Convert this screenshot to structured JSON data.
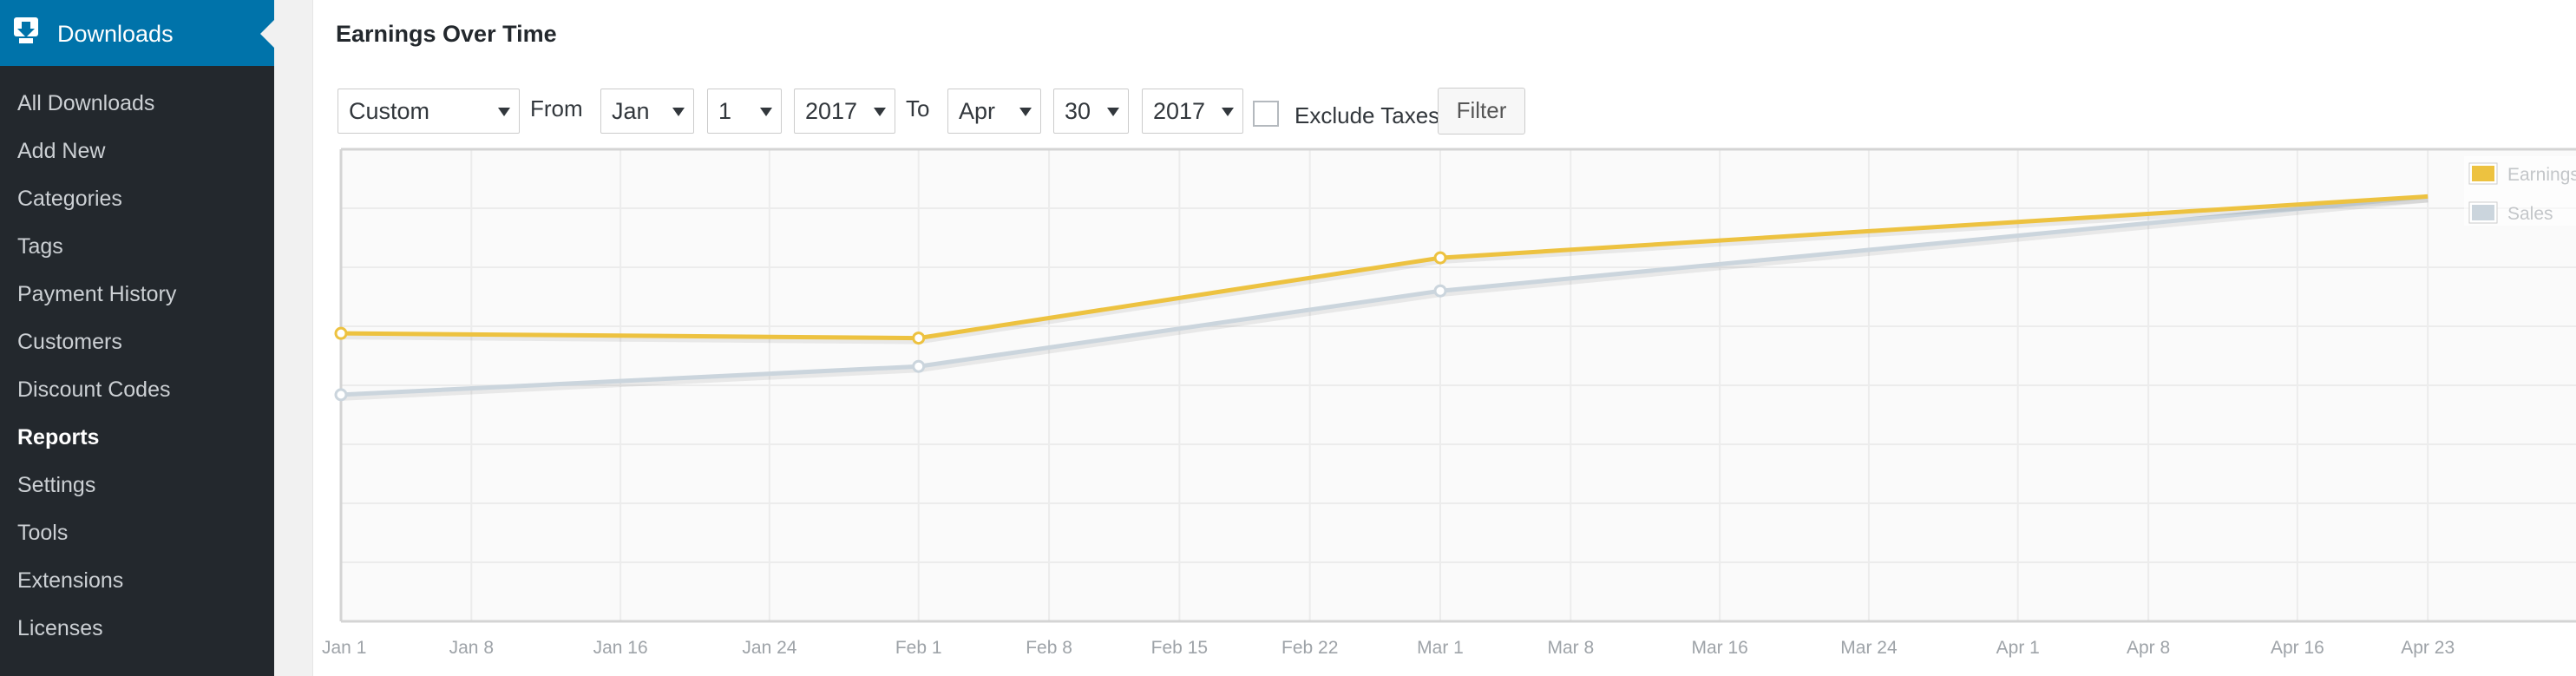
{
  "sidebar": {
    "top": {
      "label": "Downloads",
      "icon": "download-icon"
    },
    "items": [
      {
        "label": "All Downloads"
      },
      {
        "label": "Add New"
      },
      {
        "label": "Categories"
      },
      {
        "label": "Tags"
      },
      {
        "label": "Payment History"
      },
      {
        "label": "Customers"
      },
      {
        "label": "Discount Codes"
      },
      {
        "label": "Reports",
        "current": true
      },
      {
        "label": "Settings"
      },
      {
        "label": "Tools"
      },
      {
        "label": "Extensions"
      },
      {
        "label": "Licenses"
      }
    ]
  },
  "panel": {
    "title": "Earnings Over Time"
  },
  "filters": {
    "range": "Custom",
    "from_label": "From",
    "from_month": "Jan",
    "from_day": "1",
    "from_year": "2017",
    "to_label": "To",
    "to_month": "Apr",
    "to_day": "30",
    "to_year": "2017",
    "exclude_taxes_label": "Exclude Taxes",
    "exclude_taxes_checked": false,
    "filter_button": "Filter"
  },
  "colors": {
    "earnings": "#edc240",
    "sales": "#cbd5dd",
    "accent": "#0073aa"
  },
  "chart_data": {
    "type": "line",
    "x_tick_labels": [
      "Jan 1",
      "Jan 8",
      "Jan 16",
      "Jan 24",
      "Feb 1",
      "Feb 8",
      "Feb 15",
      "Feb 22",
      "Mar 1",
      "Mar 8",
      "Mar 16",
      "Mar 24",
      "Apr 1",
      "Apr 8",
      "Apr 16",
      "Apr 23"
    ],
    "x_tick_days": [
      0,
      7,
      15,
      23,
      31,
      38,
      45,
      52,
      59,
      66,
      74,
      82,
      90,
      97,
      105,
      112
    ],
    "x_range_days": [
      0,
      120
    ],
    "series": [
      {
        "name": "Earnings",
        "x_days": [
          0,
          31,
          59,
          112
        ],
        "values": [
          0.61,
          0.6,
          0.77,
          0.9
        ]
      },
      {
        "name": "Sales",
        "x_days": [
          0,
          31,
          59,
          112
        ],
        "values": [
          0.48,
          0.54,
          0.7,
          0.9
        ]
      }
    ],
    "y_range": [
      0,
      1
    ],
    "grid": true,
    "legend_position": "top-right"
  }
}
